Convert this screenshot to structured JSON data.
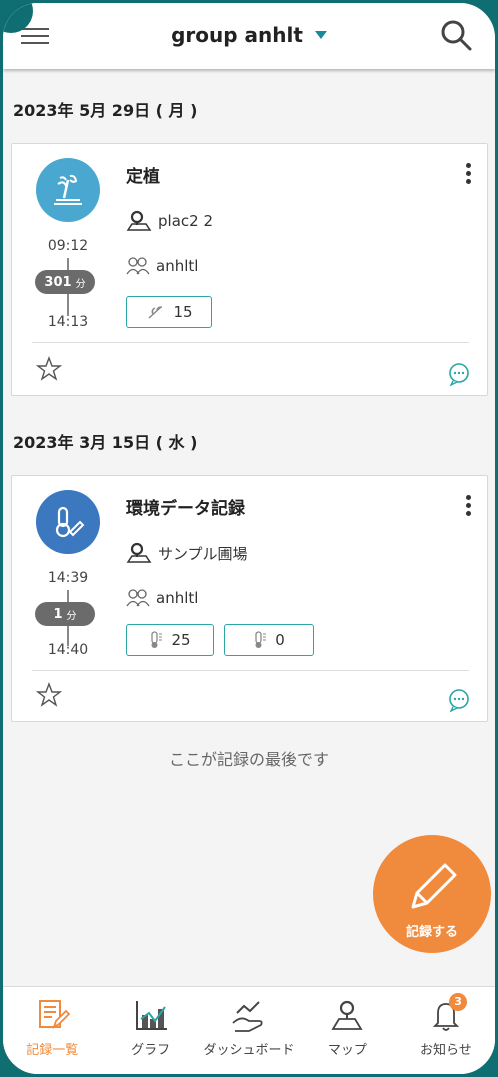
{
  "header": {
    "group_name": "group anhlt"
  },
  "records": [
    {
      "date": "2023年 5月 29日 ( 月 )",
      "title": "定植",
      "start_time": "09:12",
      "duration": "301",
      "duration_unit": "分",
      "end_time": "14:13",
      "location": "plac2 2",
      "user": "anhltl",
      "chips": [
        {
          "icon": "seedling-icon",
          "value": "15"
        }
      ],
      "icon": "planting-icon",
      "icon_color": "#4aa8d0"
    },
    {
      "date": "2023年 3月 15日 ( 水 )",
      "title": "環境データ記録",
      "start_time": "14:39",
      "duration": "1",
      "duration_unit": "分",
      "end_time": "14:40",
      "location": "サンプル圃場",
      "user": "anhltl",
      "chips": [
        {
          "icon": "thermometer-icon",
          "value": "25"
        },
        {
          "icon": "thermometer-icon",
          "value": "0"
        }
      ],
      "icon": "thermometer-pen-icon",
      "icon_color": "#3b78c0"
    }
  ],
  "end_message": "ここが記録の最後です",
  "fab": {
    "label": "記録する",
    "color": "#f08a3c"
  },
  "bottom_nav": {
    "items": [
      {
        "label": "記録一覧",
        "icon": "record-list-icon",
        "active": true
      },
      {
        "label": "グラフ",
        "icon": "graph-icon"
      },
      {
        "label": "ダッシュボード",
        "icon": "dashboard-icon"
      },
      {
        "label": "マップ",
        "icon": "map-icon"
      },
      {
        "label": "お知らせ",
        "icon": "bell-icon",
        "badge": "3"
      }
    ]
  },
  "colors": {
    "accent": "#f08a3c",
    "teal": "#2aa6a6",
    "frame": "#0f6e71"
  }
}
